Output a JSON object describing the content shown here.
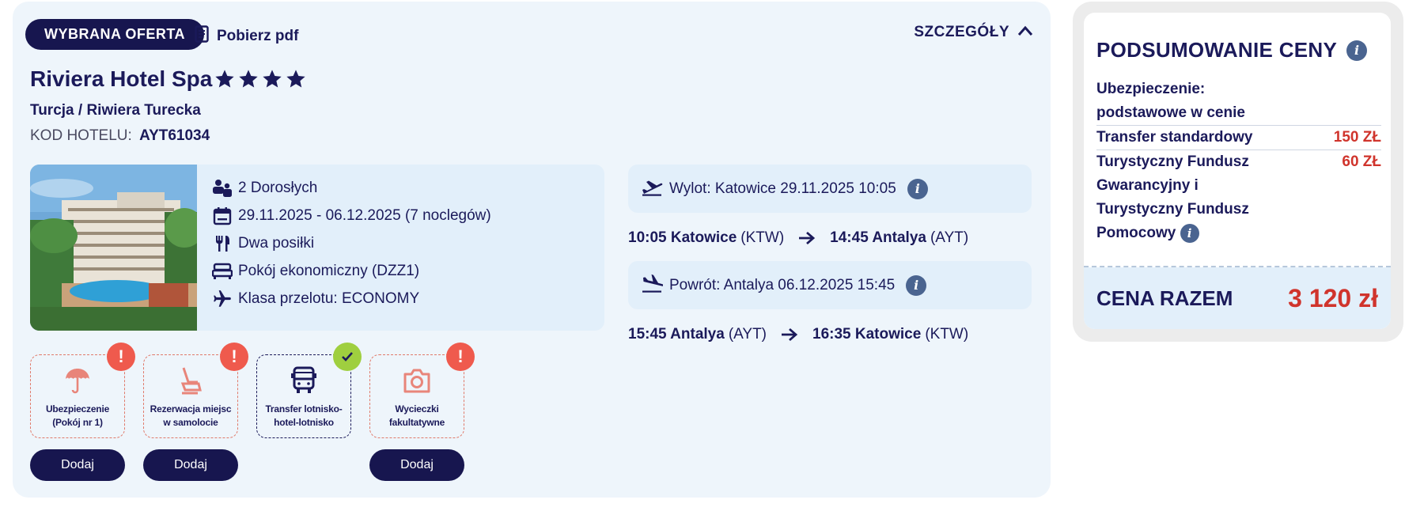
{
  "offer": {
    "badge": "WYBRANA OFERTA",
    "pdf_label": "Pobierz pdf",
    "details_label": "SZCZEGÓŁY",
    "hotel_name": "Riviera Hotel Spa",
    "stars": 4,
    "location": "Turcja / Riwiera Turecka",
    "code_label": "KOD HOTELU:",
    "code_value": "AYT61034",
    "room": {
      "guests": "2 Dorosłych",
      "dates": "29.11.2025 - 06.12.2025 (7 noclegów)",
      "board": "Dwa posiłki",
      "room_type": "Pokój ekonomiczny (DZZ1)",
      "flight_class": "Klasa przelotu: ECONOMY"
    }
  },
  "flights": {
    "outbound": {
      "pill": "Wylot: Katowice 29.11.2025 10:05",
      "dep_time_city": "10:05 Katowice",
      "dep_code": "(KTW)",
      "arr_time_city": "14:45 Antalya",
      "arr_code": "(AYT)"
    },
    "return": {
      "pill": "Powrót: Antalya 06.12.2025 15:45",
      "dep_time_city": "15:45 Antalya",
      "dep_code": "(AYT)",
      "arr_time_city": "16:35 Katowice",
      "arr_code": "(KTW)"
    }
  },
  "addons": [
    {
      "label1": "Ubezpieczenie",
      "label2": "(Pokój nr 1)",
      "status": "warning",
      "icon": "umbrella-icon",
      "button": "Dodaj"
    },
    {
      "label1": "Rezerwacja miejsc",
      "label2": "w samolocie",
      "status": "warning",
      "icon": "seat-icon",
      "button": "Dodaj"
    },
    {
      "label1": "Transfer lotnisko-",
      "label2": "hotel-lotnisko",
      "status": "included",
      "icon": "bus-icon"
    },
    {
      "label1": "Wycieczki",
      "label2": "fakultatywne",
      "status": "warning",
      "icon": "camera-icon",
      "button": "Dodaj"
    }
  ],
  "summary": {
    "title": "PODSUMOWANIE CENY",
    "insurance_label_1": "Ubezpieczenie:",
    "insurance_label_2": "podstawowe w cenie",
    "transfer_label": "Transfer standardowy",
    "transfer_price": "150 ZŁ",
    "fund_label_1": "Turystyczny Fundusz",
    "fund_label_2": "Gwarancyjny i",
    "fund_label_3": "Turystyczny Fundusz",
    "fund_label_4": "Pomocowy",
    "fund_price": "60 ZŁ",
    "total_label": "CENA RAZEM",
    "total_value": "3 120 zł"
  },
  "colors": {
    "navy": "#17164f",
    "card_bg": "#eef5fb",
    "pill_bg": "#e2effa",
    "price_red": "#d0342c",
    "warning": "#ef5a4d",
    "check": "#9fcf3f"
  }
}
